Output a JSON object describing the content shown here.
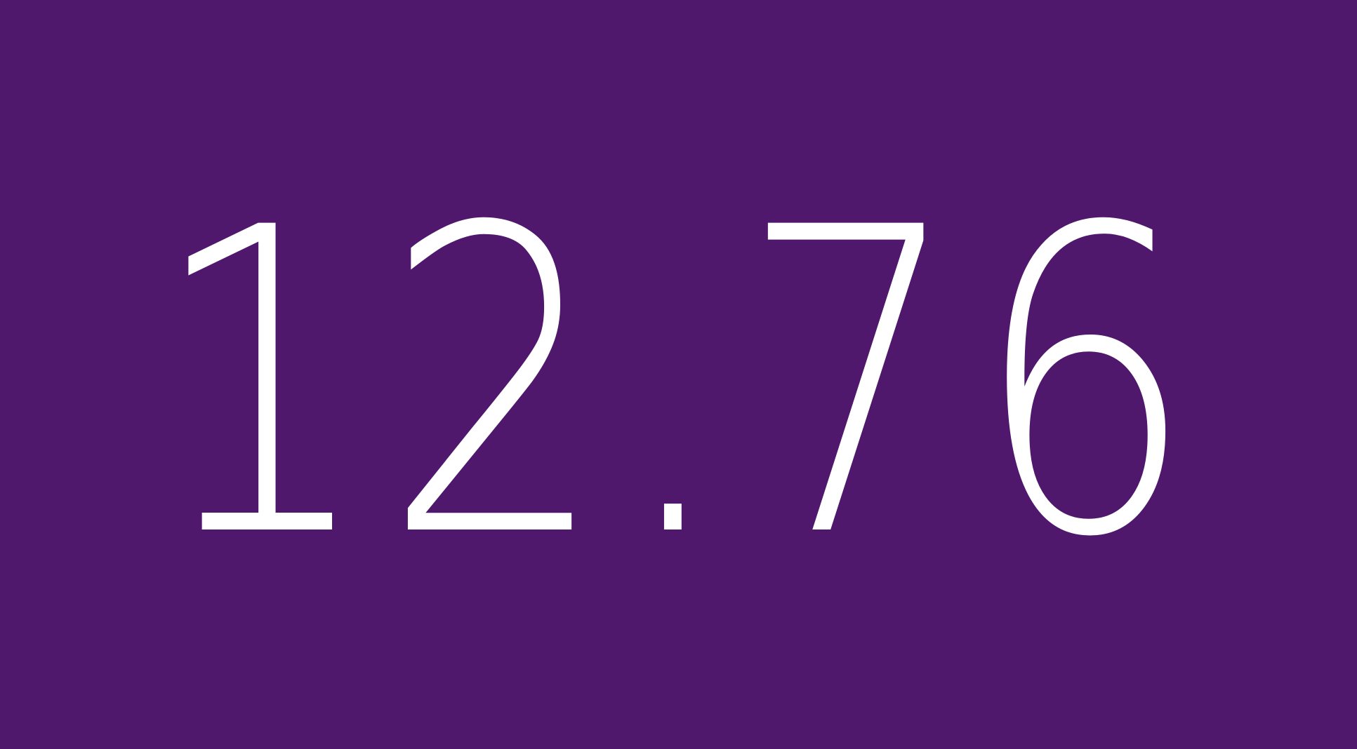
{
  "display": {
    "value": "12.76",
    "text_color": "#ffffff",
    "background_color": "#4f186d"
  }
}
